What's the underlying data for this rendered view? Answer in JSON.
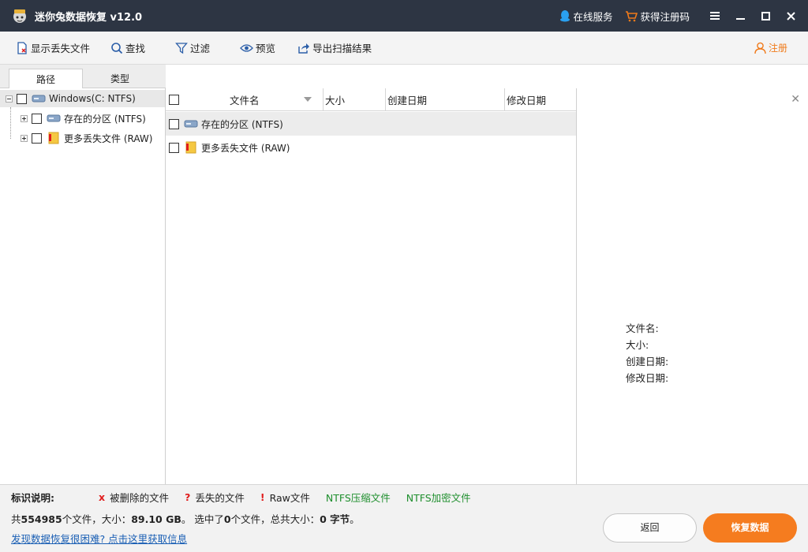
{
  "app": {
    "title": "迷你兔数据恢复 v12.0"
  },
  "titlebar": {
    "online_service": "在线服务",
    "get_code": "获得注册码"
  },
  "toolbar": {
    "show_lost": "显示丢失文件",
    "find": "查找",
    "filter": "过滤",
    "preview": "预览",
    "export": "导出扫描结果",
    "register": "注册"
  },
  "tabs": {
    "path": "路径",
    "type": "类型"
  },
  "tree": {
    "root": "Windows(C: NTFS)",
    "children": [
      "存在的分区 (NTFS)",
      "更多丢失文件 (RAW)"
    ]
  },
  "filelist": {
    "headers": {
      "name": "文件名",
      "size": "大小",
      "created": "创建日期",
      "modified": "修改日期"
    },
    "rows": [
      {
        "name": "存在的分区 (NTFS)"
      },
      {
        "name": "更多丢失文件 (RAW)"
      }
    ]
  },
  "preview": {
    "name": "文件名:",
    "size": "大小:",
    "created": "创建日期:",
    "modified": "修改日期:"
  },
  "legend": {
    "title": "标识说明:",
    "deleted_mark": "x",
    "deleted": "被删除的文件",
    "lost_mark": "?",
    "lost": "丢失的文件",
    "raw_mark": "!",
    "raw": "Raw文件",
    "ntfs_compressed": "NTFS压缩文件",
    "ntfs_encrypted": "NTFS加密文件"
  },
  "summary": {
    "prefix": "共",
    "total_files": "554985",
    "files_unit": "个文件，大小：",
    "total_size": "89.10 GB",
    "selected_prefix": "。 选中了",
    "selected_count": "0",
    "selected_mid": "个文件，总共大小：",
    "selected_size": "0 字节",
    "suffix": "。"
  },
  "bottom": {
    "help_link": "发现数据恢复很困难? 点击这里获取信息",
    "back": "返回",
    "recover": "恢复数据"
  },
  "colors": {
    "accent": "#f57c1f",
    "titlebar": "#2d3543",
    "green": "#1f8f2e",
    "red": "#e01c1c"
  }
}
